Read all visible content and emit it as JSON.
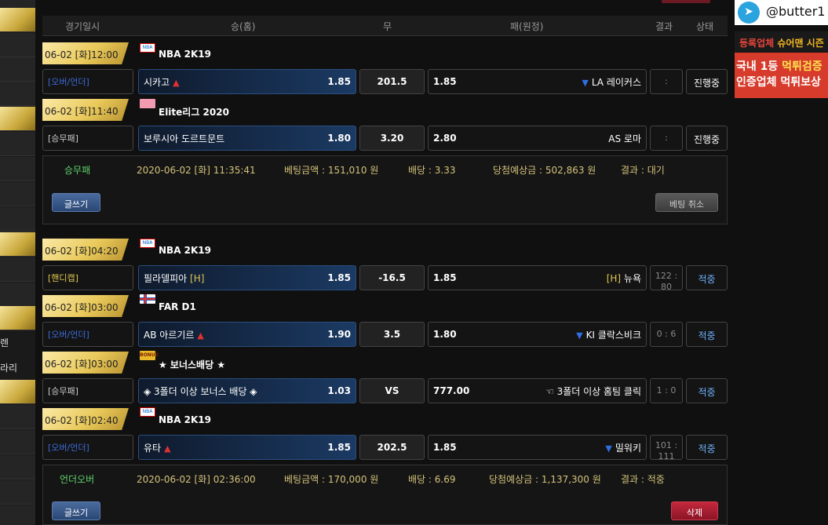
{
  "header": {
    "col_date": "경기일시",
    "col_home": "승(홈)",
    "col_draw": "무",
    "col_away": "패(원정)",
    "col_result": "결과",
    "col_status": "상태"
  },
  "left_labels": [
    "렌",
    "라리"
  ],
  "games": [
    {
      "time": "06-02 [화]12:00",
      "league": "NBA 2K19",
      "type": "[오버/언더]",
      "home": "시카고",
      "home_odd": "1.85",
      "draw": "201.5",
      "away_odd": "1.85",
      "away": "LA 레이커스",
      "score": ":",
      "status": "진행중"
    },
    {
      "time": "06-02 [화]11:40",
      "league": "Elite리그 2020",
      "type": "[승무패]",
      "home": "보루시아 도르트문트",
      "home_odd": "1.80",
      "draw": "3.20",
      "away_odd": "2.80",
      "away": "AS 로마",
      "score": ":",
      "status": "진행중"
    },
    {
      "time": "06-02 [화]04:20",
      "league": "NBA 2K19",
      "type": "[핸디캡]",
      "home": "필라델피아",
      "home_tag": "[H]",
      "home_odd": "1.85",
      "draw": "-16.5",
      "away_odd": "1.85",
      "away_tag": "[H]",
      "away": "뉴욕",
      "score_a": "122 :",
      "score_b": "80",
      "status": "적중"
    },
    {
      "time": "06-02 [화]03:00",
      "league": "FAR D1",
      "type": "[오버/언더]",
      "home": "AB 아르기르",
      "home_odd": "1.90",
      "draw": "3.5",
      "away_odd": "1.80",
      "away": "KI 클락스비크",
      "score": "0 : 6",
      "status": "적중"
    },
    {
      "time": "06-02 [화]03:00",
      "league": "★ 보너스배당 ★",
      "type": "[승무패]",
      "home": "◈ 3폴더 이상 보너스 배당 ◈",
      "home_odd": "1.03",
      "draw": "VS",
      "away_odd": "777.00",
      "away": "☜ 3폴더 이상 홈팀 클릭",
      "score": "1 : 0",
      "status": "적중"
    },
    {
      "time": "06-02 [화]02:40",
      "league": "NBA 2K19",
      "type": "[오버/언더]",
      "home": "유타",
      "home_odd": "1.85",
      "draw": "202.5",
      "away_odd": "1.85",
      "away": "밀워키",
      "score_a": "101 :",
      "score_b": "111",
      "status": "적중"
    }
  ],
  "bets": [
    {
      "kind": "승무패",
      "datetime": "2020-06-02 [화] 11:35:41",
      "amount": "베팅금액 : 151,010 원",
      "rate": "배당 : 3.33",
      "expected": "당첨예상금 : 502,863 원",
      "result": "결과 : 대기",
      "write_label": "글쓰기",
      "action_label": "베팅 취소"
    },
    {
      "kind": "언더오버",
      "datetime": "2020-06-02 [화] 02:36:00",
      "amount": "베팅금액 : 170,000 원",
      "rate": "배당 : 6.69",
      "expected": "당첨예상금 : 1,137,300 원",
      "result": "결과 : 적중",
      "write_label": "글쓰기",
      "action_label": "삭제"
    }
  ],
  "league_icon_labels": {
    "nba": "NBA",
    "bonus": "BONUS"
  },
  "right": {
    "telegram_glyph": "➤",
    "telegram": "@butter1",
    "banner1_a": "등록업체",
    "banner1_b": "슈어맨 시즌",
    "banner2_line1_a": "국내 1등",
    "banner2_line1_b": "먹튀검증",
    "banner2_line2": "인증업체 먹튀보상"
  },
  "icons": {
    "up": "▲",
    "down": "▼"
  },
  "colors": {
    "accent_blue": "#6fb3ff",
    "gold": "#e9c95a",
    "win_green": "#5fd36b",
    "delete_red": "#c4283d"
  }
}
